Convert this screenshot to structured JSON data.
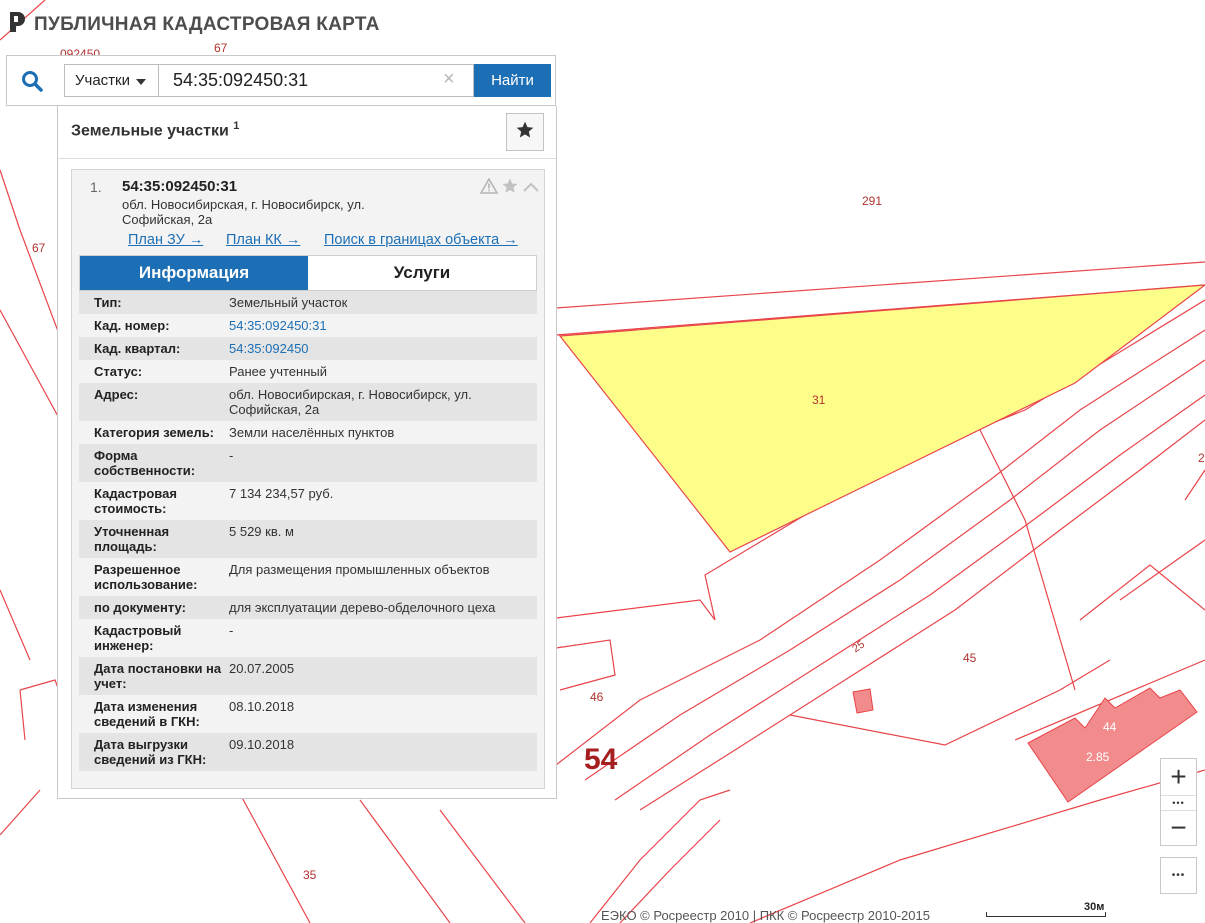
{
  "app": {
    "title": "ПУБЛИЧНАЯ КАДАСТРОВАЯ КАРТА",
    "logo_icon": "pkk-logo-icon"
  },
  "search": {
    "type_label": "Участки",
    "query": "54:35:092450:31",
    "find_label": "Найти",
    "clear_icon": "×"
  },
  "results": {
    "title": "Земельные участки",
    "count": "1",
    "items": [
      {
        "index": "1.",
        "cad_number": "54:35:092450:31",
        "address": "обл. Новосибирская, г. Новосибирск, ул. Софийская, 2а",
        "links": [
          "План ЗУ →",
          "План КК →",
          "Поиск в границах объекта →"
        ]
      }
    ]
  },
  "tabs": {
    "info": "Информация",
    "services": "Услуги"
  },
  "info_rows": [
    {
      "k": "Тип:",
      "v": "Земельный участок"
    },
    {
      "k": "Кад. номер:",
      "v": "54:35:092450:31"
    },
    {
      "k": "Кад. квартал:",
      "v": "54:35:092450"
    },
    {
      "k": "Статус:",
      "v": "Ранее учтенный"
    },
    {
      "k": "Адрес:",
      "v": "обл. Новосибирская, г. Новосибирск, ул. Софийская, 2а"
    },
    {
      "k": "Категория земель:",
      "v": "Земли населённых пунктов"
    },
    {
      "k": "Форма собственности:",
      "v": "-"
    },
    {
      "k": "Кадастровая стоимость:",
      "v": "7 134 234,57 руб."
    },
    {
      "k": "Уточненная площадь:",
      "v": "5 529 кв. м"
    },
    {
      "k": "Разрешенное использование:",
      "v": "Для размещения промышленных объектов"
    },
    {
      "k": "по документу:",
      "v": "для эксплуатации дерево-обделочного цеха"
    },
    {
      "k": "Кадастровый инженер:",
      "v": "-"
    },
    {
      "k": "Дата постановки на учет:",
      "v": "20.07.2005"
    },
    {
      "k": "Дата изменения сведений в ГКН:",
      "v": "08.10.2018"
    },
    {
      "k": "Дата выгрузки сведений из ГКН:",
      "v": "09.10.2018"
    }
  ],
  "map": {
    "labels": {
      "top_quarter": "092450",
      "l67a": "67",
      "l67b": "67",
      "l291": "291",
      "l31": "31",
      "l2": "2",
      "l25": "25",
      "l45": "45",
      "l46": "46",
      "l44": "44",
      "l285": "2.85",
      "l54": "54",
      "l35": "35"
    },
    "colors": {
      "boundary": "#e8454a",
      "selected_fill": "#fdfd8a",
      "building_fill": "#f28c8c",
      "accent": "#1d6fb5"
    }
  },
  "controls": {
    "zoom_in": "+",
    "zoom_out": "−",
    "more": "•••"
  },
  "footer": {
    "copyright": "ЕЭКО © Росреестр 2010 | ПКК © Росреестр 2010-2015",
    "scale": "30м"
  }
}
